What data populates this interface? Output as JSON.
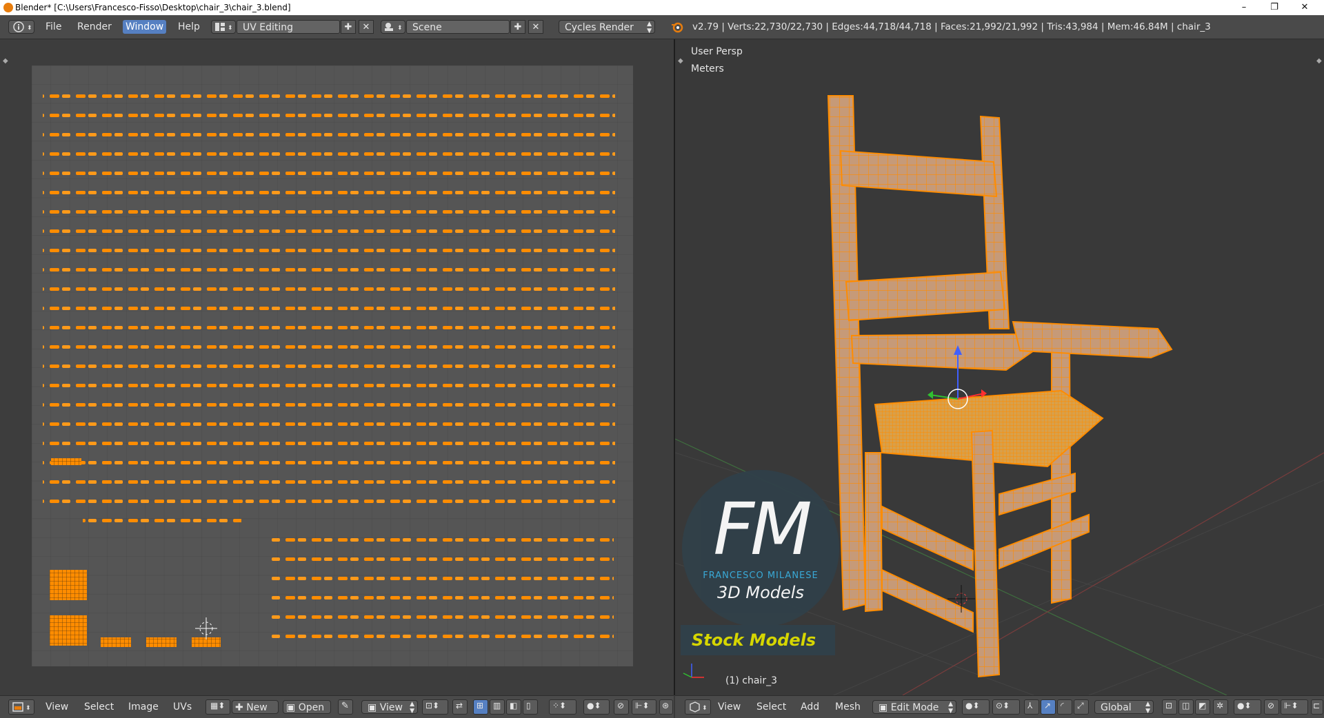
{
  "titlebar": {
    "title": "Blender* [C:\\Users\\Francesco-Fisso\\Desktop\\chair_3\\chair_3.blend]",
    "minimize": "–",
    "maximize": "❐",
    "close": "✕"
  },
  "topbar": {
    "menus": [
      "File",
      "Render",
      "Window",
      "Help"
    ],
    "active_menu": "Window",
    "screen_layout": "UV Editing",
    "scene": "Scene",
    "render_engine": "Cycles Render",
    "stats": "v2.79 | Verts:22,730/22,730 | Edges:44,718/44,718 | Faces:21,992/21,992 | Tris:43,984 | Mem:46.84M | chair_3"
  },
  "uv_editor": {
    "menus": [
      "View",
      "Select",
      "Image",
      "UVs"
    ],
    "new_label": "New",
    "open_label": "Open",
    "view_label": "View"
  },
  "viewport": {
    "view_name": "User Persp",
    "units": "Meters",
    "object_label": "(1) chair_3",
    "menus": [
      "View",
      "Select",
      "Add",
      "Mesh"
    ],
    "mode": "Edit Mode",
    "orientation": "Global"
  },
  "watermark": {
    "logo": "FM",
    "brand": "FRANCESCO MILANESE",
    "subtitle": "3D Models",
    "badge": "Stock Models"
  },
  "colors": {
    "accent": "#5680c2",
    "selection_orange": "#ff8c00",
    "chair_wood": "#c69a78"
  }
}
